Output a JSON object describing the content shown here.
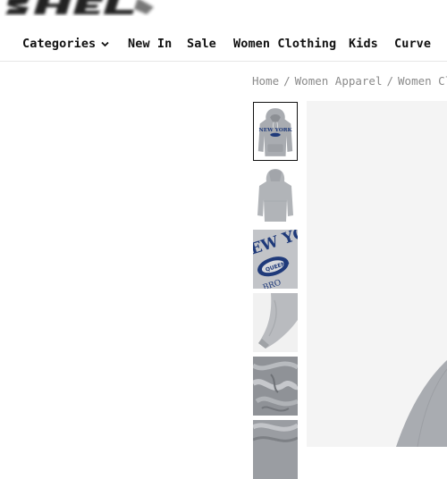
{
  "nav": {
    "items": [
      {
        "label": "Categories",
        "has_dropdown": true
      },
      {
        "label": "New In"
      },
      {
        "label": "Sale"
      },
      {
        "label": "Women Clothing"
      },
      {
        "label": "Kids"
      },
      {
        "label": "Curve"
      }
    ]
  },
  "breadcrumb": {
    "items": [
      "Home",
      "Women Apparel",
      "Women Clo"
    ],
    "separator": "/"
  },
  "gallery": {
    "selected_index": 0,
    "thumbnails": [
      {
        "alt": "Grey hoodie front",
        "print": "NEW YORK"
      },
      {
        "alt": "Grey hoodie back"
      },
      {
        "alt": "Print closeup"
      },
      {
        "alt": "Sleeve cuff detail"
      },
      {
        "alt": "Fabric texture"
      },
      {
        "alt": "Fabric detail"
      }
    ]
  },
  "colors": {
    "hoodie_grey": "#a9acb1",
    "print_navy": "#1f3a7a",
    "breadcrumb_text": "#8a8a8a",
    "main_bg": "#f4f4f4"
  }
}
